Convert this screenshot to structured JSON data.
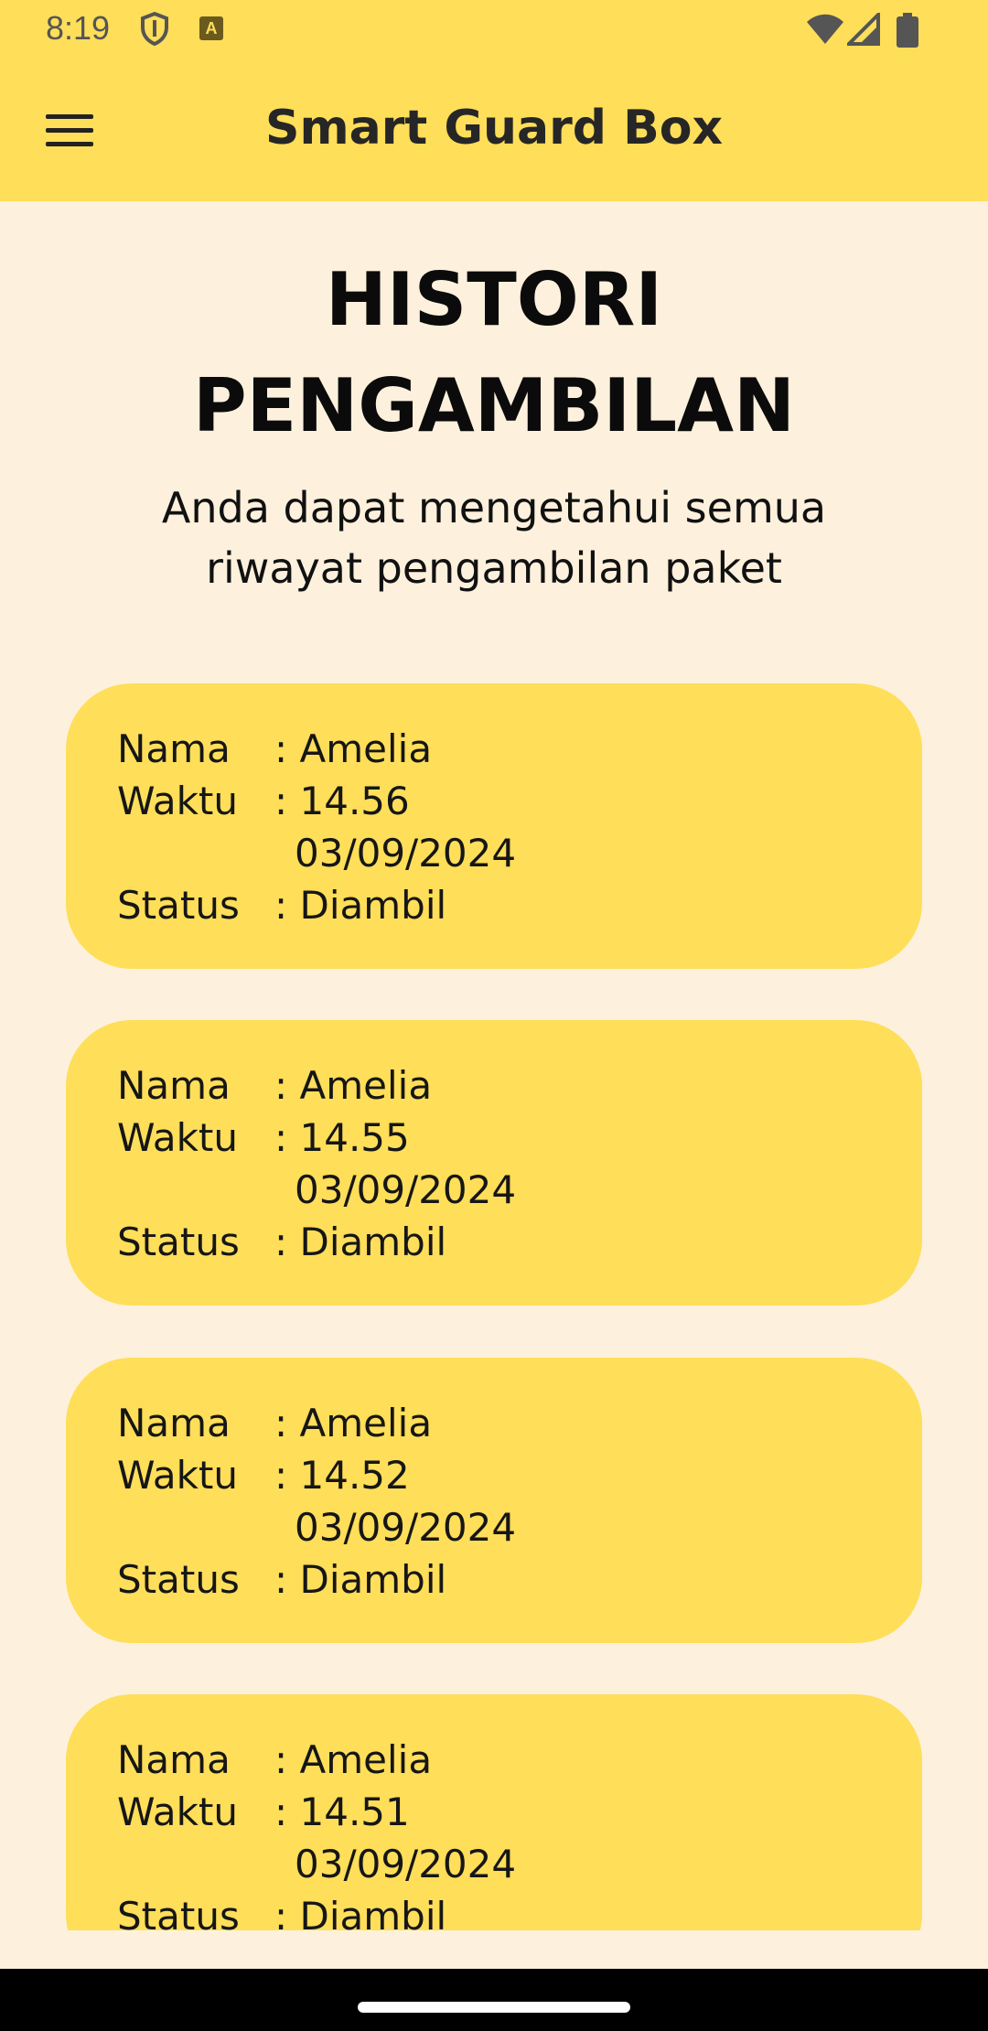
{
  "status_bar": {
    "time": "8:19"
  },
  "app_bar": {
    "title": "Smart Guard Box"
  },
  "page": {
    "heading_line1": "HISTORI",
    "heading_line2": "PENGAMBILAN",
    "subtitle": "Anda dapat mengetahui semua riwayat pengambilan paket"
  },
  "labels": {
    "name": "Nama",
    "time": "Waktu",
    "status": "Status"
  },
  "history": [
    {
      "name": ": Amelia",
      "time": ": 14.56",
      "date": "03/09/2024",
      "status": ": Diambil"
    },
    {
      "name": ": Amelia",
      "time": ": 14.55",
      "date": "03/09/2024",
      "status": ": Diambil"
    },
    {
      "name": ": Amelia",
      "time": ": 14.52",
      "date": "03/09/2024",
      "status": ": Diambil"
    },
    {
      "name": ": Amelia",
      "time": ": 14.51",
      "date": "03/09/2024",
      "status": ": Diambil"
    }
  ],
  "colors": {
    "accent": "#FFDE59",
    "background": "#FDF1DD"
  },
  "icons": [
    "menu-icon",
    "shield-icon",
    "keyboard-a-icon",
    "wifi-icon",
    "signal-icon",
    "battery-icon"
  ]
}
